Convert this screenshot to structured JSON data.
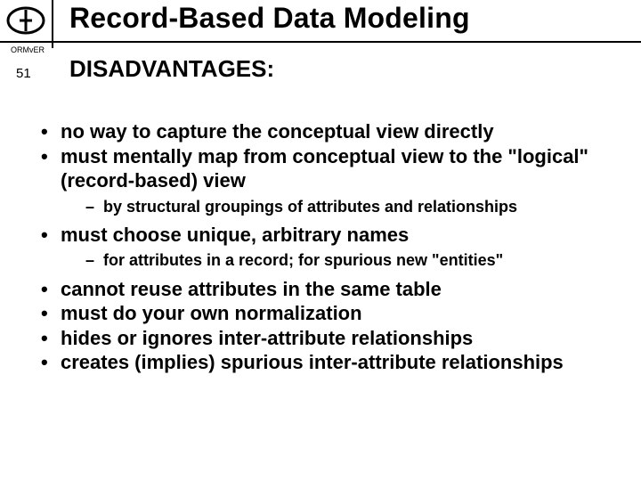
{
  "header": {
    "tag": "ORMvER",
    "title": "Record-Based Data Modeling",
    "page_number": "51"
  },
  "subtitle": "DISADVANTAGES:",
  "bullets": [
    {
      "text": "no way to capture the conceptual view directly",
      "sub": []
    },
    {
      "text": "must mentally map from conceptual view to the \"logical\" (record-based) view",
      "sub": [
        "by structural groupings of attributes and relationships"
      ]
    },
    {
      "text": "must choose unique, arbitrary names",
      "sub": [
        "for attributes in a record;  for spurious new \"entities\""
      ]
    },
    {
      "text": "cannot reuse attributes in the same table",
      "sub": []
    },
    {
      "text": "must do your own normalization",
      "sub": []
    },
    {
      "text": "hides or ignores inter-attribute relationships",
      "sub": []
    },
    {
      "text": "creates (implies) spurious inter-attribute relationships",
      "sub": []
    }
  ]
}
